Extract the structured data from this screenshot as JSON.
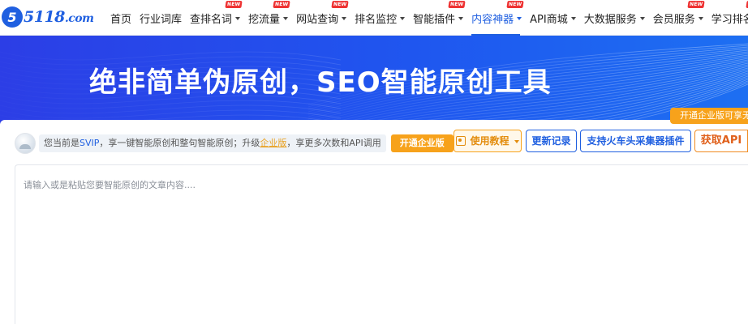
{
  "logo": {
    "mark": "5",
    "text": "5118",
    "suffix": ".com"
  },
  "nav": [
    {
      "label": "首页",
      "caret": false,
      "new": false,
      "active": false
    },
    {
      "label": "行业词库",
      "caret": false,
      "new": false,
      "active": false
    },
    {
      "label": "查排名词",
      "caret": true,
      "new": true,
      "active": false
    },
    {
      "label": "挖流量",
      "caret": true,
      "new": true,
      "active": false
    },
    {
      "label": "网站查询",
      "caret": true,
      "new": true,
      "active": false
    },
    {
      "label": "排名监控",
      "caret": true,
      "new": false,
      "active": false
    },
    {
      "label": "智能插件",
      "caret": true,
      "new": true,
      "active": false
    },
    {
      "label": "内容神器",
      "caret": true,
      "new": true,
      "active": true
    },
    {
      "label": "API商城",
      "caret": true,
      "new": false,
      "active": false
    },
    {
      "label": "大数据服务",
      "caret": true,
      "new": false,
      "active": false
    },
    {
      "label": "会员服务",
      "caret": true,
      "new": true,
      "active": false
    },
    {
      "label": "学习排名",
      "caret": true,
      "new": true,
      "active": false
    }
  ],
  "new_badge": "NEW",
  "hero": {
    "title": "绝非简单伪原创，SEO智能原创工具"
  },
  "tip": {
    "text": "开通企业版可享无"
  },
  "notice": {
    "prefix": "您当前是",
    "level": "SVIP",
    "middle": "，享一键智能原创和整句智能原创；升级",
    "link": "企业版",
    "suffix": "，享更多次数和API调用"
  },
  "buttons": {
    "enterprise": "开通企业版",
    "tutorial": "使用教程",
    "update_log": "更新记录",
    "plugin": "支持火车头采集器插件",
    "api": "获取API"
  },
  "editor": {
    "placeholder": "请输入或是粘贴您要智能原创的文章内容...."
  },
  "colors": {
    "brand_blue": "#1f5fe0",
    "accent_orange": "#f7a21b",
    "badge_red": "#e33"
  }
}
